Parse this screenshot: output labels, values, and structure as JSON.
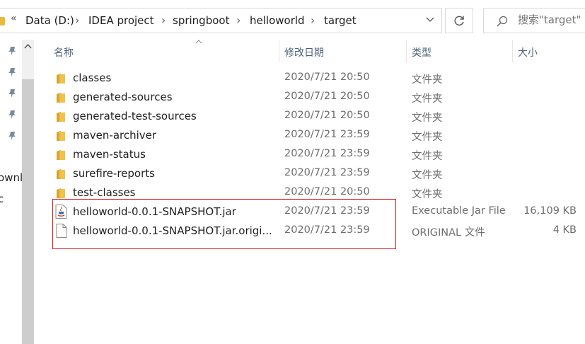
{
  "address_bar": {
    "overflow": "«",
    "breadcrumbs": [
      "Data (D:)",
      "IDEA project",
      "springboot",
      "helloworld",
      "target"
    ]
  },
  "search": {
    "placeholder": "搜索\"target\""
  },
  "nav_pane": {
    "partial_labels": [
      "ownl",
      "c"
    ]
  },
  "columns": {
    "name": "名称",
    "date": "修改日期",
    "type": "类型",
    "size": "大小"
  },
  "files": [
    {
      "name": "classes",
      "date": "2020/7/21 20:50",
      "type": "文件夹",
      "size": "",
      "icon": "folder-icon"
    },
    {
      "name": "generated-sources",
      "date": "2020/7/21 20:50",
      "type": "文件夹",
      "size": "",
      "icon": "folder-icon"
    },
    {
      "name": "generated-test-sources",
      "date": "2020/7/21 20:50",
      "type": "文件夹",
      "size": "",
      "icon": "folder-icon"
    },
    {
      "name": "maven-archiver",
      "date": "2020/7/21 23:59",
      "type": "文件夹",
      "size": "",
      "icon": "folder-icon"
    },
    {
      "name": "maven-status",
      "date": "2020/7/21 23:59",
      "type": "文件夹",
      "size": "",
      "icon": "folder-icon"
    },
    {
      "name": "surefire-reports",
      "date": "2020/7/21 23:59",
      "type": "文件夹",
      "size": "",
      "icon": "folder-icon"
    },
    {
      "name": "test-classes",
      "date": "2020/7/21 20:50",
      "type": "文件夹",
      "size": "",
      "icon": "folder-icon"
    },
    {
      "name": "helloworld-0.0.1-SNAPSHOT.jar",
      "date": "2020/7/21 23:59",
      "type": "Executable Jar File",
      "size": "16,109 KB",
      "icon": "java-jar-icon"
    },
    {
      "name": "helloworld-0.0.1-SNAPSHOT.jar.origi...",
      "date": "2020/7/21 23:59",
      "type": "ORIGINAL 文件",
      "size": "4 KB",
      "icon": "generic-file-icon"
    }
  ],
  "colors": {
    "folder": "#e8b93b",
    "highlight": "#e01818",
    "header_text": "#4c607a"
  }
}
